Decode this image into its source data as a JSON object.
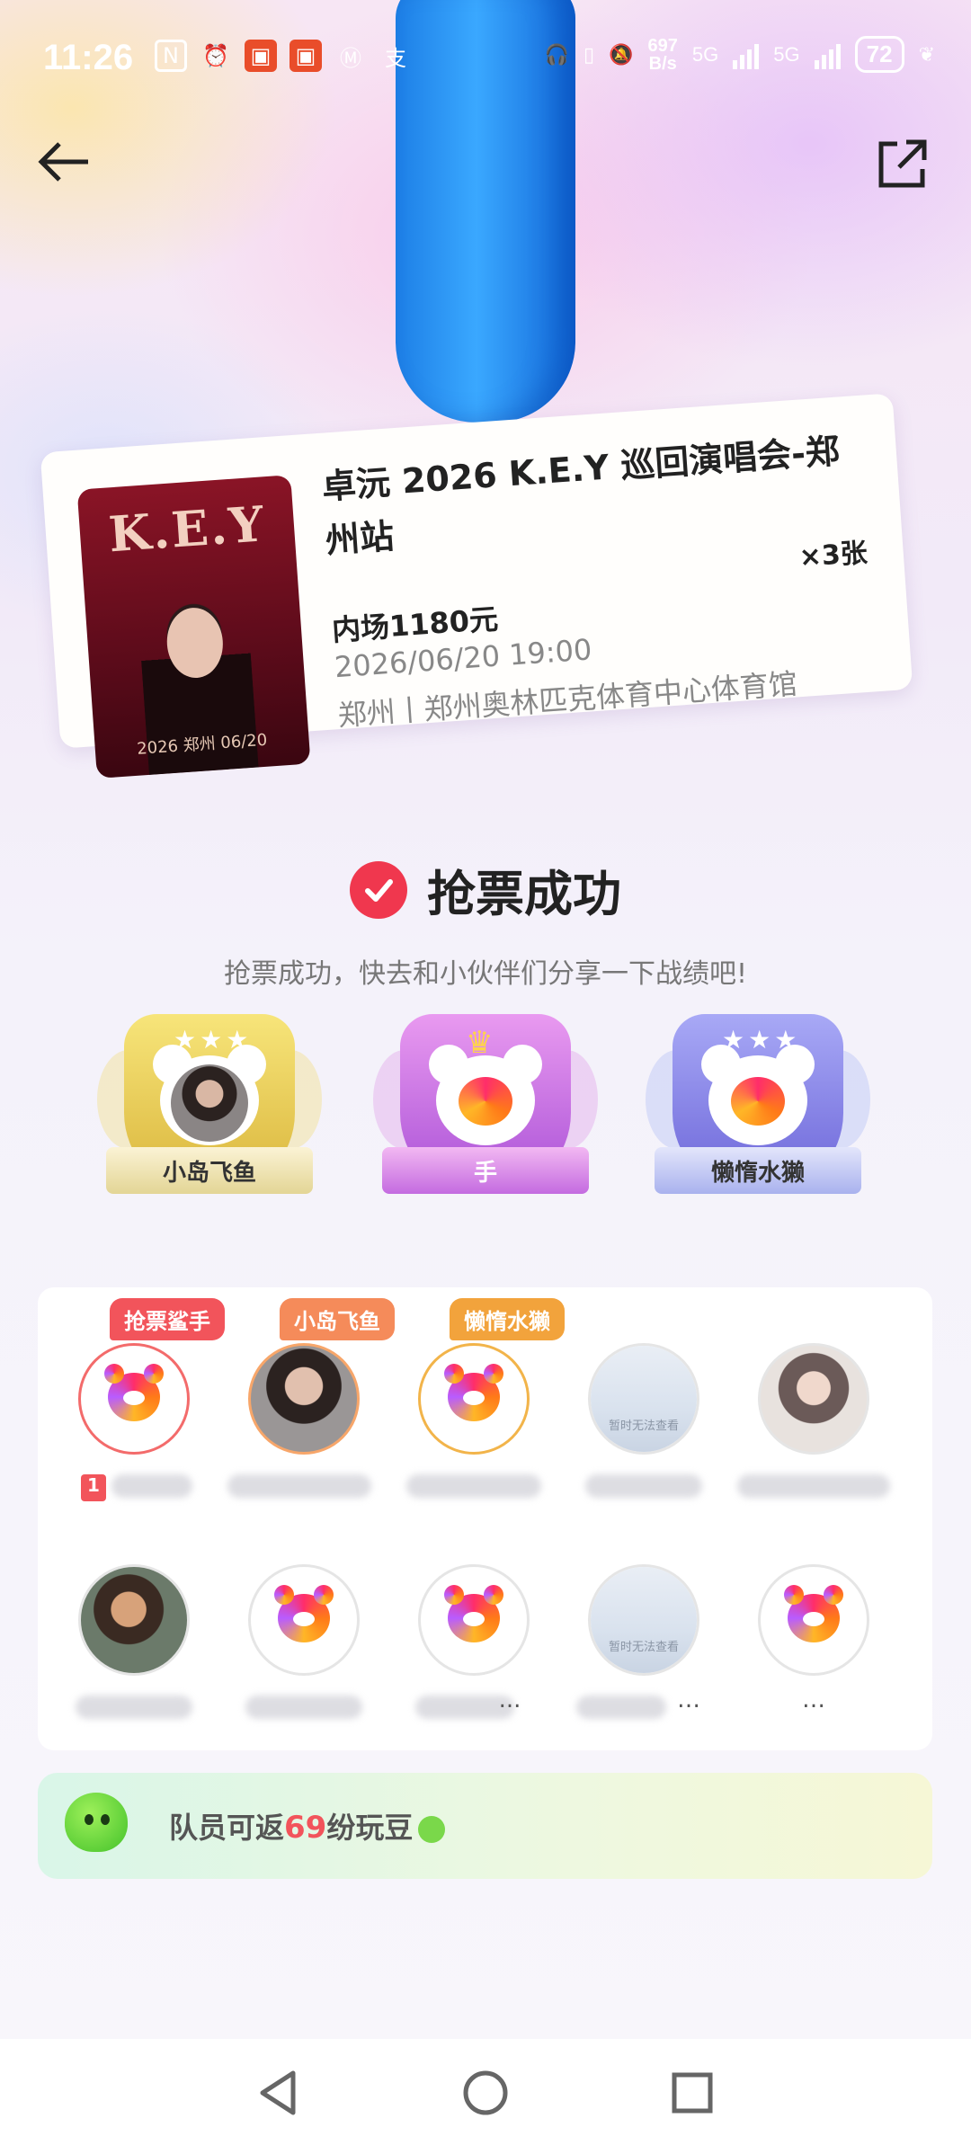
{
  "status_bar": {
    "time": "11:26",
    "net_speed_value": "697",
    "net_speed_unit": "B/s",
    "signal1_label": "5G",
    "signal2_label": "5G",
    "battery": "72"
  },
  "ticket": {
    "title": "卓沅 2026 K.E.Y 巡回演唱会-郑州站",
    "quantity": "×3张",
    "price": "内场1180元",
    "datetime": "2026/06/20 19:00",
    "venue": "郑州丨郑州奥林匹克体育中心体育馆",
    "poster_title": "K.E.Y",
    "poster_city": "郑州",
    "poster_year": "2026",
    "poster_date": "06/20"
  },
  "success": {
    "title": "抢票成功",
    "subtitle": "抢票成功，快去和小伙伴们分享一下战绩吧!"
  },
  "badges": [
    {
      "label": "小岛飞鱼"
    },
    {
      "label": "手"
    },
    {
      "label": "懒惰水獭"
    }
  ],
  "members": [
    {
      "tag": "抢票鲨手",
      "name": ""
    },
    {
      "tag": "小岛飞鱼",
      "name": ""
    },
    {
      "tag": "懒惰水獭",
      "name": ""
    },
    {
      "tag": "",
      "name": "",
      "placeholder": "暂时无法查看"
    },
    {
      "tag": "",
      "name": ""
    },
    {
      "tag": "",
      "name": ""
    },
    {
      "tag": "",
      "name": ""
    },
    {
      "tag": "",
      "name": "..."
    },
    {
      "tag": "",
      "name": "…",
      "placeholder": "暂时无法查看"
    },
    {
      "tag": "",
      "name": "…"
    }
  ],
  "rank_badge": "1",
  "reward": {
    "prefix": "队员可返",
    "number": "69",
    "suffix": "纷玩豆"
  },
  "colors": {
    "accent_red": "#f2545b",
    "check_red": "#f0374e"
  }
}
